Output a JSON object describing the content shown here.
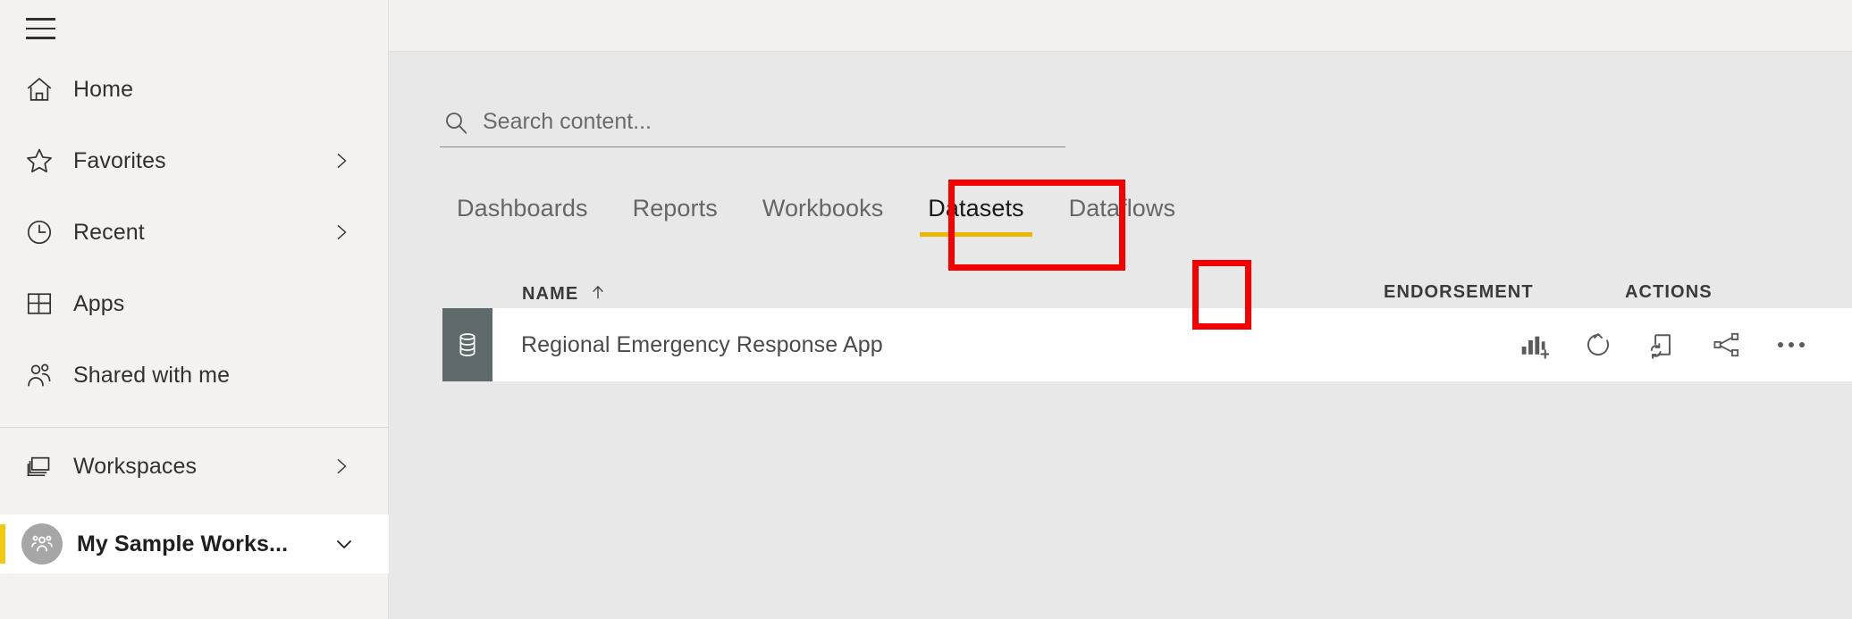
{
  "app": {
    "hamburger_label": "Expand navigation"
  },
  "sidebar": {
    "items": [
      {
        "label": "Home",
        "icon": "home-icon",
        "chevron": false
      },
      {
        "label": "Favorites",
        "icon": "star-icon",
        "chevron": true
      },
      {
        "label": "Recent",
        "icon": "clock-icon",
        "chevron": true
      },
      {
        "label": "Apps",
        "icon": "apps-grid-icon",
        "chevron": false
      },
      {
        "label": "Shared with me",
        "icon": "people-icon",
        "chevron": false
      },
      {
        "label": "Workspaces",
        "icon": "workspaces-icon",
        "chevron": true
      }
    ],
    "selected_workspace": {
      "label": "My Sample Works...",
      "avatar_icon": "group-avatar-icon",
      "chevron_icon": "chevron-down-icon",
      "accent_color": "#f2c811"
    }
  },
  "search": {
    "placeholder": "Search content...",
    "value": "",
    "icon": "search-icon"
  },
  "tabs": {
    "items": [
      {
        "label": "Dashboards",
        "active": false
      },
      {
        "label": "Reports",
        "active": false
      },
      {
        "label": "Workbooks",
        "active": false
      },
      {
        "label": "Datasets",
        "active": true
      },
      {
        "label": "Dataflows",
        "active": false
      }
    ],
    "active_underline_color": "#e8b800",
    "highlight_color": "#f40000"
  },
  "table": {
    "columns": {
      "name": "NAME",
      "name_sort_icon": "sort-ascending-arrow",
      "endorsement": "ENDORSEMENT",
      "actions": "ACTIONS"
    },
    "rows": [
      {
        "name": "Regional Emergency Response App",
        "tile_icon": "dataset-database-icon",
        "tile_color": "#5e6a6b",
        "endorsement": "",
        "actions": [
          {
            "name": "create-report-button",
            "icon": "bar-chart-plus-icon",
            "highlighted": false
          },
          {
            "name": "refresh-now-button",
            "icon": "refresh-circle-icon",
            "highlighted": false
          },
          {
            "name": "schedule-refresh-button",
            "icon": "schedule-refresh-icon",
            "highlighted": true
          },
          {
            "name": "share-button",
            "icon": "share-nodes-icon",
            "highlighted": false
          },
          {
            "name": "more-options-button",
            "icon": "ellipsis-icon",
            "highlighted": false
          }
        ]
      }
    ]
  }
}
